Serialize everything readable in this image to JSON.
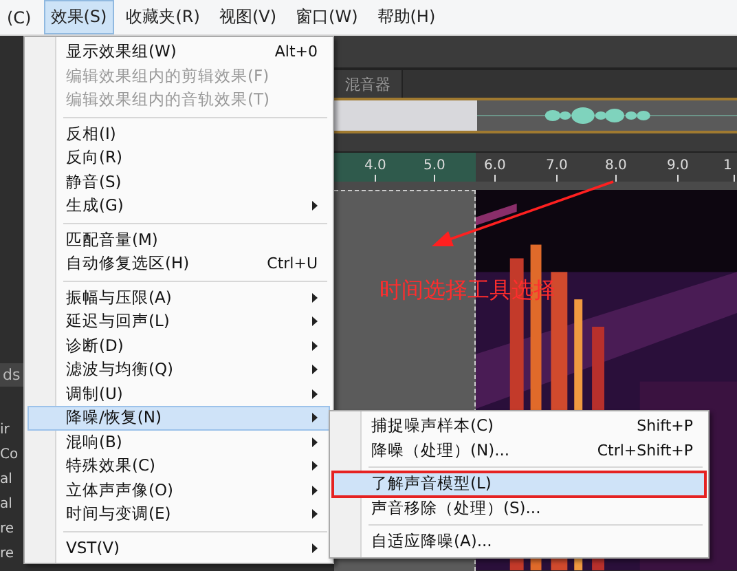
{
  "menubar": [
    {
      "label": "(C)",
      "selected": false
    },
    {
      "label": "效果(S)",
      "selected": true
    },
    {
      "label": "收藏夹(R)",
      "selected": false
    },
    {
      "label": "视图(V)",
      "selected": false
    },
    {
      "label": "窗口(W)",
      "selected": false
    },
    {
      "label": "帮助(H)",
      "selected": false
    }
  ],
  "left_panel": {
    "tab": "ds",
    "items": [
      "ir",
      "Co",
      "al",
      "al",
      "re",
      "re"
    ]
  },
  "mixer_tab": "混音器",
  "ruler": {
    "labels": [
      "4.0",
      "5.0",
      "6.0",
      "7.0",
      "8.0",
      "9.0",
      "1"
    ]
  },
  "annotation": {
    "text": "时间选择工具选择"
  },
  "menu": [
    {
      "kind": "item",
      "label": "显示效果组(W)",
      "shortcut": "Alt+0",
      "disabled": false,
      "submenu": false,
      "selected": false
    },
    {
      "kind": "item",
      "label": "编辑效果组内的剪辑效果(F)",
      "disabled": true,
      "submenu": false,
      "selected": false
    },
    {
      "kind": "item",
      "label": "编辑效果组内的音轨效果(T)",
      "disabled": true,
      "submenu": false,
      "selected": false
    },
    {
      "kind": "separator"
    },
    {
      "kind": "item",
      "label": "反相(I)",
      "disabled": false,
      "submenu": false,
      "selected": false
    },
    {
      "kind": "item",
      "label": "反向(R)",
      "disabled": false,
      "submenu": false,
      "selected": false
    },
    {
      "kind": "item",
      "label": "静音(S)",
      "disabled": false,
      "submenu": false,
      "selected": false
    },
    {
      "kind": "item",
      "label": "生成(G)",
      "disabled": false,
      "submenu": true,
      "selected": false
    },
    {
      "kind": "separator"
    },
    {
      "kind": "item",
      "label": "匹配音量(M)",
      "disabled": false,
      "submenu": false,
      "selected": false
    },
    {
      "kind": "item",
      "label": "自动修复选区(H)",
      "shortcut": "Ctrl+U",
      "disabled": false,
      "submenu": false,
      "selected": false
    },
    {
      "kind": "separator"
    },
    {
      "kind": "item",
      "label": "振幅与压限(A)",
      "disabled": false,
      "submenu": true,
      "selected": false
    },
    {
      "kind": "item",
      "label": "延迟与回声(L)",
      "disabled": false,
      "submenu": true,
      "selected": false
    },
    {
      "kind": "item",
      "label": "诊断(D)",
      "disabled": false,
      "submenu": true,
      "selected": false
    },
    {
      "kind": "item",
      "label": "滤波与均衡(Q)",
      "disabled": false,
      "submenu": true,
      "selected": false
    },
    {
      "kind": "item",
      "label": "调制(U)",
      "disabled": false,
      "submenu": true,
      "selected": false
    },
    {
      "kind": "item",
      "label": "降噪/恢复(N)",
      "disabled": false,
      "submenu": true,
      "selected": true
    },
    {
      "kind": "item",
      "label": "混响(B)",
      "disabled": false,
      "submenu": true,
      "selected": false
    },
    {
      "kind": "item",
      "label": "特殊效果(C)",
      "disabled": false,
      "submenu": true,
      "selected": false
    },
    {
      "kind": "item",
      "label": "立体声声像(O)",
      "disabled": false,
      "submenu": true,
      "selected": false
    },
    {
      "kind": "item",
      "label": "时间与变调(E)",
      "disabled": false,
      "submenu": true,
      "selected": false
    },
    {
      "kind": "separator"
    },
    {
      "kind": "item",
      "label": "VST(V)",
      "disabled": false,
      "submenu": true,
      "selected": false
    }
  ],
  "submenu": [
    {
      "kind": "item",
      "label": "捕捉噪声样本(C)",
      "shortcut": "Shift+P",
      "selected": false,
      "outlined": false
    },
    {
      "kind": "item",
      "label": "降噪（处理）(N)...",
      "shortcut": "Ctrl+Shift+P",
      "selected": false,
      "outlined": false
    },
    {
      "kind": "separator"
    },
    {
      "kind": "item",
      "label": "了解声音模型(L)",
      "selected": true,
      "outlined": true
    },
    {
      "kind": "item",
      "label": "声音移除（处理）(S)...",
      "selected": false,
      "outlined": false
    },
    {
      "kind": "separator"
    },
    {
      "kind": "item",
      "label": "自适应降噪(A)...",
      "selected": false,
      "outlined": false
    }
  ]
}
